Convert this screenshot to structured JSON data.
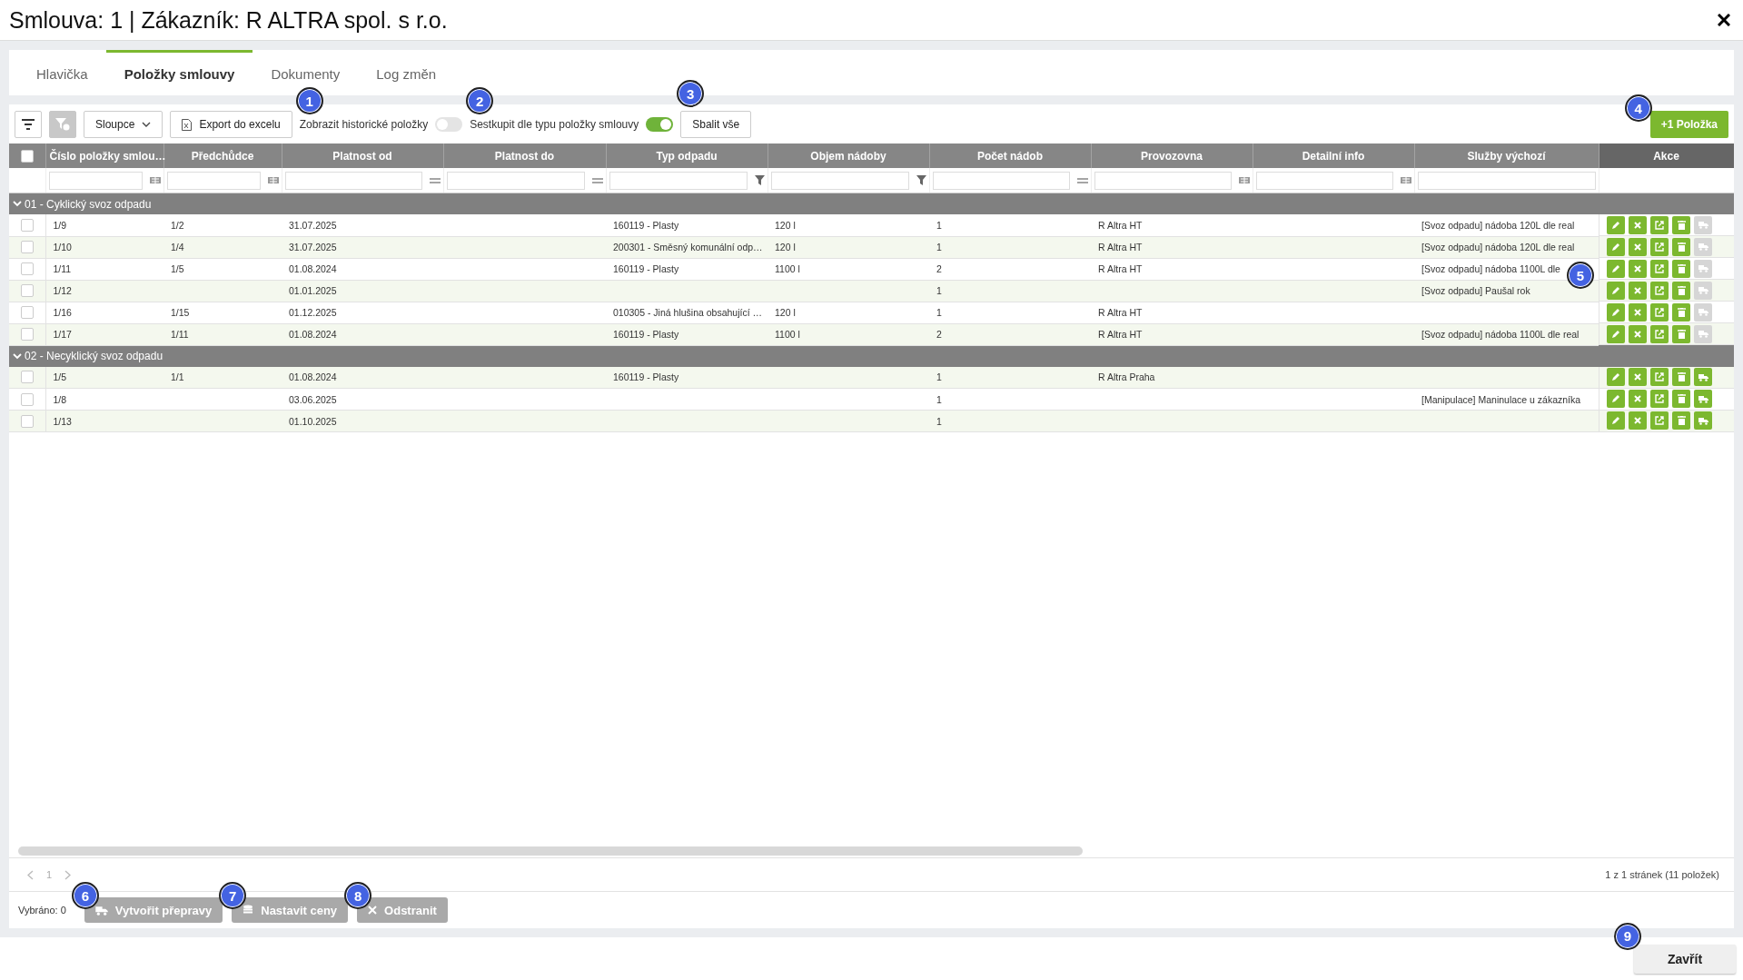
{
  "window": {
    "title": "Smlouva: 1 | Zákazník: R ALTRA spol. s r.o."
  },
  "tabs": [
    {
      "label": "Hlavička",
      "selected": false
    },
    {
      "label": "Položky smlouvy",
      "selected": true
    },
    {
      "label": "Dokumenty",
      "selected": false
    },
    {
      "label": "Log změn",
      "selected": false
    }
  ],
  "toolbar": {
    "clear_filter_disabled": true,
    "columns_button": {
      "label": "Sloupce"
    },
    "export_button": {
      "label": "Export do excelu"
    },
    "history_toggle": {
      "label": "Zobrazit historické položky",
      "on": false,
      "callout": "1"
    },
    "group_toggle": {
      "label": "Sestkupit dle typu položky smlouvy",
      "on": true,
      "callout": "2"
    },
    "collapse_button": {
      "label": "Sbalit vše",
      "callout": "3"
    },
    "add_button": {
      "label": "+1 Položka",
      "callout": "4"
    }
  },
  "table": {
    "select_all_checked": false,
    "columns": [
      {
        "label": "Číslo položky smlou…",
        "kind": "text"
      },
      {
        "label": "Předchůdce",
        "kind": "text"
      },
      {
        "label": "Platnost od",
        "kind": "equals"
      },
      {
        "label": "Platnost do",
        "kind": "equals"
      },
      {
        "label": "Typ odpadu",
        "kind": "list"
      },
      {
        "label": "Objem nádoby",
        "kind": "list"
      },
      {
        "label": "Počet nádob",
        "kind": "equals"
      },
      {
        "label": "Provozovna",
        "kind": "text"
      },
      {
        "label": "Detailní info",
        "kind": "text"
      },
      {
        "label": "Služby výchozí",
        "kind": "plain"
      }
    ],
    "actions_label": "Akce",
    "groups": [
      {
        "label": "01 - Cyklický svoz odpadu",
        "expanded": true,
        "rows": [
          {
            "checked": false,
            "transport_enabled": false,
            "cells": [
              "1/9",
              "1/2",
              "31.07.2025",
              "",
              "160119 - Plasty",
              "120 l",
              "1",
              "R Altra HT",
              "",
              "[Svoz odpadu] nádoba 120L dle real"
            ]
          },
          {
            "checked": false,
            "transport_enabled": false,
            "cells": [
              "1/10",
              "1/4",
              "31.07.2025",
              "",
              "200301 - Směsný komunální odp…",
              "120 l",
              "1",
              "R Altra HT",
              "",
              "[Svoz odpadu] nádoba 120L dle real"
            ]
          },
          {
            "checked": false,
            "transport_enabled": false,
            "callout": "5",
            "cells": [
              "1/11",
              "1/5",
              "01.08.2024",
              "",
              "160119 - Plasty",
              "1100 l",
              "2",
              "R Altra HT",
              "",
              "[Svoz odpadu] nádoba 1100L dle"
            ]
          },
          {
            "checked": false,
            "transport_enabled": false,
            "cells": [
              "1/12",
              "",
              "01.01.2025",
              "",
              "",
              "",
              "1",
              "",
              "",
              "[Svoz odpadu] Paušal rok"
            ]
          },
          {
            "checked": false,
            "transport_enabled": false,
            "cells": [
              "1/16",
              "1/15",
              "01.12.2025",
              "",
              "010305 - Jiná hlušina obsahující …",
              "120 l",
              "1",
              "R Altra HT",
              "",
              ""
            ]
          },
          {
            "checked": false,
            "transport_enabled": false,
            "cells": [
              "1/17",
              "1/11",
              "01.08.2024",
              "",
              "160119 - Plasty",
              "1100 l",
              "2",
              "R Altra HT",
              "",
              "[Svoz odpadu] nádoba 1100L dle real"
            ]
          }
        ]
      },
      {
        "label": "02 - Necyklický svoz odpadu",
        "expanded": true,
        "rows": [
          {
            "checked": false,
            "transport_enabled": true,
            "cells": [
              "1/5",
              "1/1",
              "01.08.2024",
              "",
              "160119 - Plasty",
              "",
              "1",
              "R Altra Praha",
              "",
              ""
            ]
          },
          {
            "checked": false,
            "transport_enabled": true,
            "cells": [
              "1/8",
              "",
              "03.06.2025",
              "",
              "",
              "",
              "1",
              "",
              "",
              "[Manipulace] Maninulace u zákazníka"
            ]
          },
          {
            "checked": false,
            "transport_enabled": true,
            "cells": [
              "1/13",
              "",
              "01.10.2025",
              "",
              "",
              "",
              "1",
              "",
              "",
              ""
            ]
          }
        ]
      }
    ]
  },
  "pager": {
    "page": "1",
    "summary": "1 z 1 stránek (11 položek)"
  },
  "selection_bar": {
    "label": "Vybráno: 0",
    "buttons": [
      {
        "kind": "truck",
        "label": "Vytvořit přepravy",
        "disabled": true,
        "callout": "6"
      },
      {
        "kind": "coins",
        "label": "Nastavit ceny",
        "disabled": true,
        "callout": "7"
      },
      {
        "kind": "remove",
        "label": "Odstranit",
        "disabled": true,
        "callout": "8"
      }
    ]
  },
  "close_button": {
    "label": "Zavřít",
    "callout": "9"
  }
}
